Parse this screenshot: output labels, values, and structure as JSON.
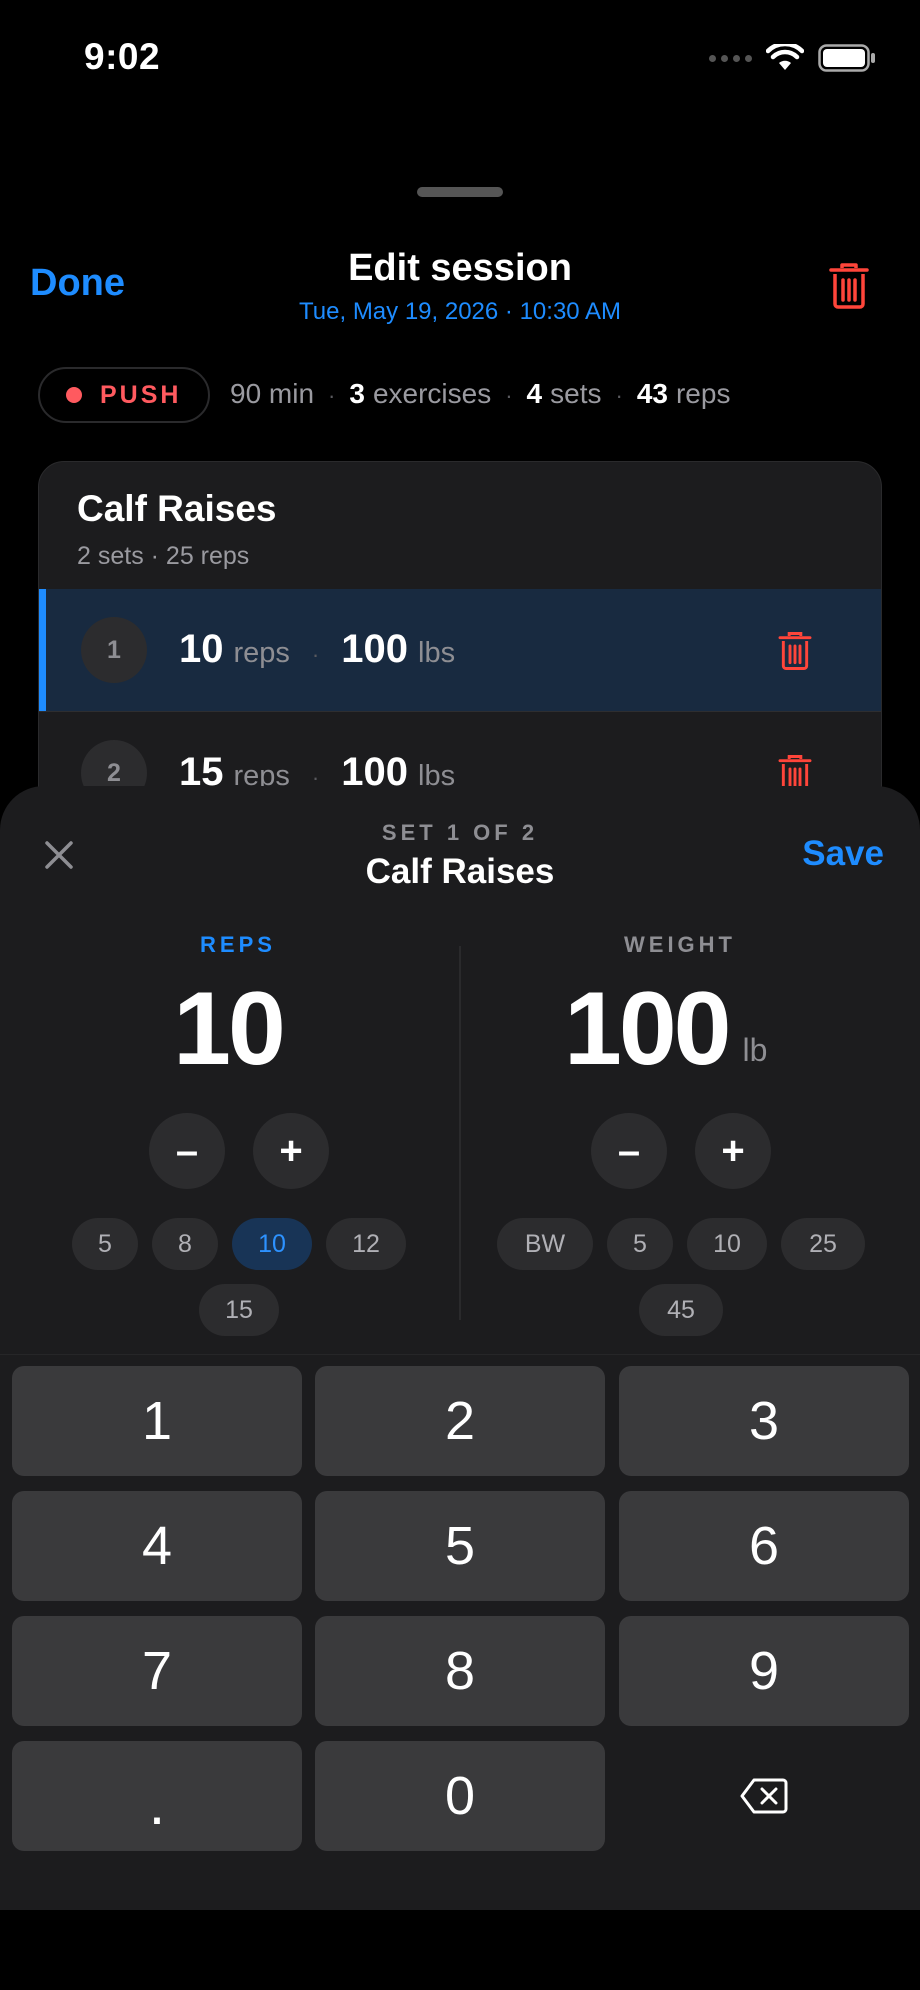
{
  "status_bar": {
    "time": "9:02",
    "signal_icon": "signal-dots-icon",
    "wifi_icon": "wifi-icon",
    "battery_icon": "battery-icon"
  },
  "header": {
    "done_label": "Done",
    "title": "Edit session",
    "subtitle": "Tue, May 19, 2026 · 10:30 AM",
    "delete_icon": "trash-icon"
  },
  "summary": {
    "badge_label": "PUSH",
    "duration": "90 min",
    "exercises_count": "3",
    "exercises_label": "exercises",
    "sets_count": "4",
    "sets_label": "sets",
    "reps_count": "43",
    "reps_label": "reps",
    "separator": "·"
  },
  "exercise_card": {
    "title": "Calf Raises",
    "subtitle": "2 sets · 25 reps",
    "sets": [
      {
        "number": "1",
        "reps": "10",
        "reps_unit": "reps",
        "weight": "100",
        "weight_unit": "lbs",
        "active": true
      },
      {
        "number": "2",
        "reps": "15",
        "reps_unit": "reps",
        "weight": "100",
        "weight_unit": "lbs",
        "active": false
      }
    ]
  },
  "editor": {
    "set_indicator": "SET 1 OF 2",
    "title": "Calf Raises",
    "save_label": "Save",
    "close_icon": "close-icon",
    "reps": {
      "label": "REPS",
      "value": "10",
      "decrement": "–",
      "increment": "+",
      "presets": [
        "5",
        "8",
        "10",
        "12",
        "15"
      ],
      "selected_preset": "10"
    },
    "weight": {
      "label": "WEIGHT",
      "value": "100",
      "unit": "lb",
      "decrement": "–",
      "increment": "+",
      "presets": [
        "BW",
        "5",
        "10",
        "25",
        "45"
      ]
    }
  },
  "keypad": {
    "keys": [
      "1",
      "2",
      "3",
      "4",
      "5",
      "6",
      "7",
      "8",
      "9",
      ".",
      "0"
    ],
    "backspace_icon": "backspace-icon"
  },
  "colors": {
    "accent": "#1e8cff",
    "danger": "#ff5a5f",
    "background": "#000000",
    "surface": "#1c1c1e"
  }
}
